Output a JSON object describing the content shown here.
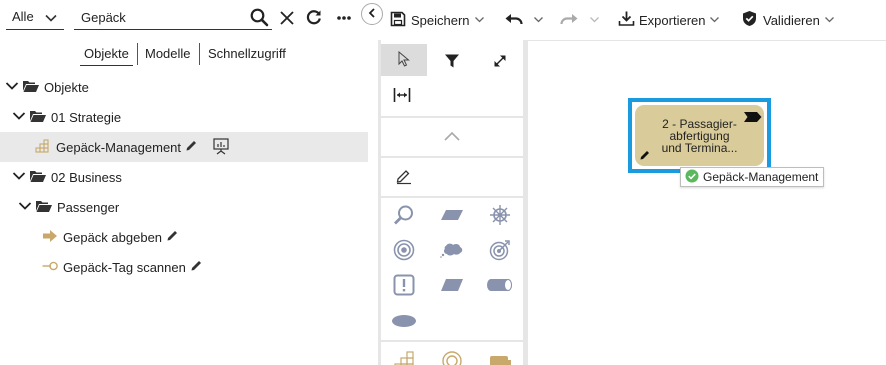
{
  "filter": {
    "selected": "Alle"
  },
  "search": {
    "value": "Gepäck",
    "placeholder": ""
  },
  "tabs": [
    {
      "label": "Objekte",
      "active": true
    },
    {
      "label": "Modelle",
      "active": false
    },
    {
      "label": "Schnellzugriff",
      "active": false
    }
  ],
  "tree": [
    {
      "label": "Objekte",
      "icon": "folder-open-icon",
      "expanded": true
    },
    {
      "label": "01 Strategie",
      "icon": "folder-open-icon",
      "expanded": true
    },
    {
      "label": "Gepäck-Management",
      "icon": "capability-icon",
      "selected": true
    },
    {
      "label": "02 Business",
      "icon": "folder-open-icon",
      "expanded": true
    },
    {
      "label": "Passenger",
      "icon": "folder-open-icon",
      "expanded": true
    },
    {
      "label": "Gepäck abgeben",
      "icon": "arrow-right-icon"
    },
    {
      "label": "Gepäck-Tag scannen",
      "icon": "event-icon"
    }
  ],
  "toolbar": {
    "save_label": "Speichern",
    "export_label": "Exportieren",
    "validate_label": "Validieren"
  },
  "canvas": {
    "node_label_lines": [
      "2 - Passagier-",
      "abfertigung",
      "und Termina..."
    ],
    "tooltip": "Gepäck-Management"
  },
  "colors": {
    "accent": "#1a9be0",
    "node_fill": "#d9cc9a",
    "palette_icon": "#8a93ae",
    "tree_icon_gold": "#c8a96b",
    "success": "#5cb85c"
  }
}
